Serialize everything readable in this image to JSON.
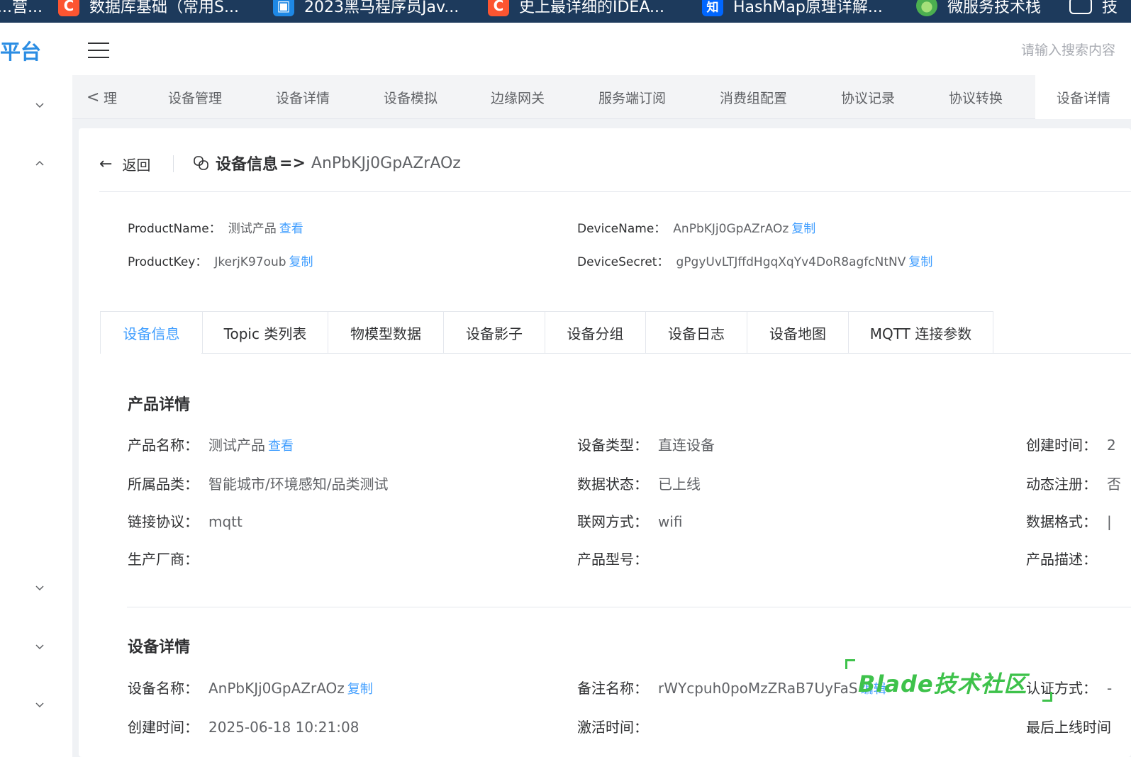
{
  "browser": {
    "bookmarks": [
      {
        "label": "...营...",
        "color": "#1d3a5c",
        "icon": ""
      },
      {
        "label": "数据库基础（常用S...",
        "color": "#fc5531",
        "icon": "C"
      },
      {
        "label": "2023黑马程序员Jav...",
        "color": "#1e88e5",
        "icon": "▣"
      },
      {
        "label": "史上最详细的IDEA...",
        "color": "#fc5531",
        "icon": "C"
      },
      {
        "label": "HashMap原理详解...",
        "color": "#0066ff",
        "icon": "知"
      },
      {
        "label": "微服务技术栈",
        "color": "#4caf50",
        "icon": "●"
      },
      {
        "label": "技",
        "color": "#1d3a5c",
        "icon": "▭"
      }
    ]
  },
  "header": {
    "logo": "平台",
    "search_placeholder": "请输入搜索内容"
  },
  "tabs": {
    "left_arrow": "<",
    "items": [
      {
        "label": "理",
        "active": false
      },
      {
        "label": "设备管理",
        "active": false
      },
      {
        "label": "设备详情",
        "active": false
      },
      {
        "label": "设备模拟",
        "active": false
      },
      {
        "label": "边缘网关",
        "active": false
      },
      {
        "label": "服务端订阅",
        "active": false
      },
      {
        "label": "消费组配置",
        "active": false
      },
      {
        "label": "协议记录",
        "active": false
      },
      {
        "label": "协议转换",
        "active": false
      },
      {
        "label": "设备详情",
        "active": true
      }
    ]
  },
  "page": {
    "back_label": "返回",
    "title_bold": "设备信息",
    "title_arrow": "=>",
    "title_device": "AnPbKJj0GpAZrAOz"
  },
  "summary": {
    "product_name_key": "ProductName：",
    "product_name_val": "测试产品",
    "product_name_link": "查看",
    "device_name_key": "DeviceName：",
    "device_name_val": "AnPbKJj0GpAZrAOz",
    "device_name_link": "复制",
    "product_key_key": "ProductKey：",
    "product_key_val": "JkerjK97oub",
    "product_key_link": "复制",
    "device_secret_key": "DeviceSecret：",
    "device_secret_val": "gPgyUvLTJffdHgqXqYv4DoR8agfcNtNV",
    "device_secret_link": "复制"
  },
  "detail_tabs": [
    {
      "label": "设备信息",
      "active": true
    },
    {
      "label": "Topic 类列表",
      "active": false
    },
    {
      "label": "物模型数据",
      "active": false
    },
    {
      "label": "设备影子",
      "active": false
    },
    {
      "label": "设备分组",
      "active": false
    },
    {
      "label": "设备日志",
      "active": false
    },
    {
      "label": "设备地图",
      "active": false
    },
    {
      "label": "MQTT 连接参数",
      "active": false
    }
  ],
  "product_section": {
    "title": "产品详情",
    "product_name_key": "产品名称：",
    "product_name_val": "测试产品",
    "product_name_link": "查看",
    "category_key": "所属品类：",
    "category_val": "智能城市/环境感知/品类测试",
    "protocol_key": "链接协议：",
    "protocol_val": "mqtt",
    "manufacturer_key": "生产厂商：",
    "device_type_key": "设备类型：",
    "device_type_val": "直连设备",
    "data_status_key": "数据状态：",
    "data_status_val": "已上线",
    "network_key": "联网方式：",
    "network_val": "wifi",
    "model_key": "产品型号：",
    "created_key": "创建时间：",
    "created_val": "2",
    "dynamic_key": "动态注册：",
    "dynamic_val": "否",
    "format_key": "数据格式：",
    "format_val": "|",
    "desc_key": "产品描述："
  },
  "device_section": {
    "title": "设备详情",
    "device_name_key": "设备名称：",
    "device_name_val": "AnPbKJj0GpAZrAOz",
    "device_name_link": "复制",
    "created_key": "创建时间：",
    "created_val": "2025-06-18 10:21:08",
    "remark_key": "备注名称：",
    "remark_val": "rWYcpuh0poMzZRaB7UyFaS",
    "remark_link": "编辑",
    "activated_key": "激活时间：",
    "auth_key": "认证方式：",
    "auth_val": "-",
    "last_online_key": "最后上线时间"
  },
  "watermark": "Blade技术社区",
  "colors": {
    "primary": "#409eff",
    "logo": "#2b8de3",
    "watermark": "#3ec24b",
    "bookmark_bar": "#1d3a5c"
  }
}
